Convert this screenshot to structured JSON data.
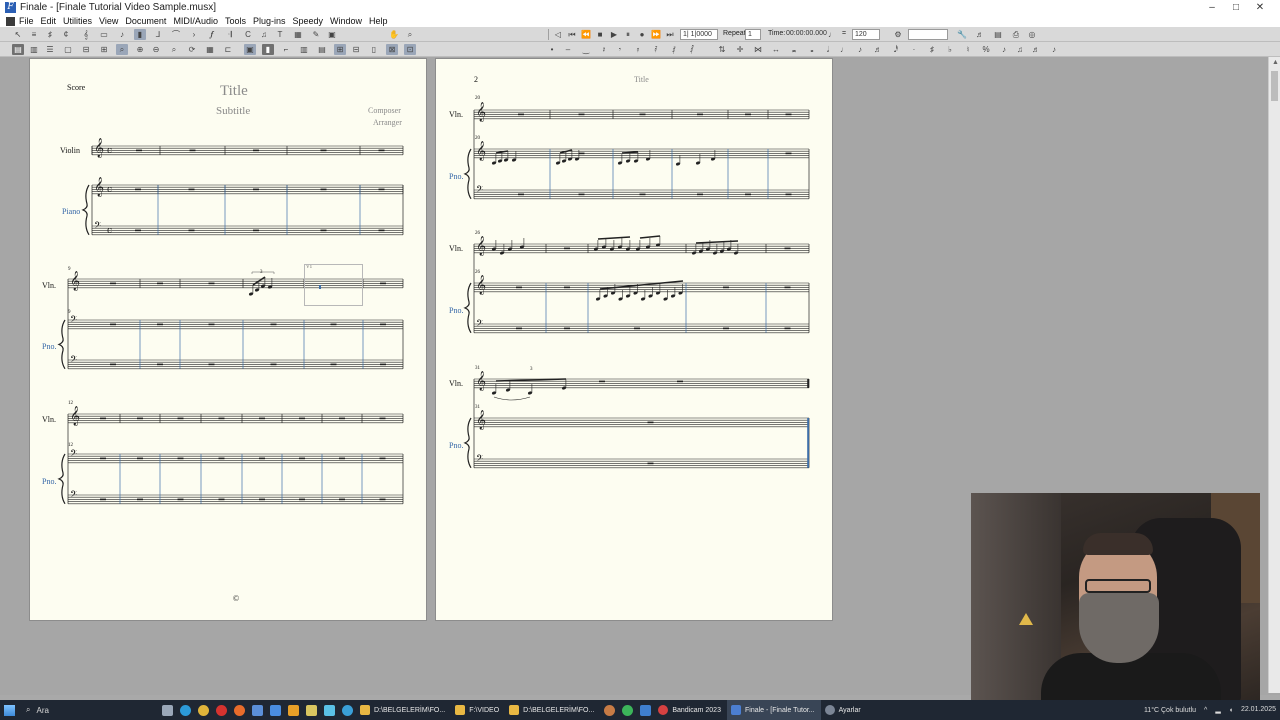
{
  "window": {
    "title": "Finale - [Finale Tutorial Video Sample.musx]",
    "controls": [
      "–",
      "□",
      "✕"
    ]
  },
  "menu": [
    "File",
    "Edit",
    "Utilities",
    "View",
    "Document",
    "MIDI/Audio",
    "Tools",
    "Plug-ins",
    "Speedy",
    "Window",
    "Help"
  ],
  "playback": {
    "counter": "1| 1|0000",
    "repeat_label": "Repeat:",
    "repeat_value": "1",
    "time_label": "Time:",
    "time_value": "00:00:00.000",
    "tempo_eq": "=",
    "tempo_value": "120"
  },
  "page1": {
    "score_label": "Score",
    "title": "Title",
    "subtitle": "Subtitle",
    "composer": "Composer",
    "arranger": "Arranger",
    "violin_label": "Violin",
    "piano_label": "Piano",
    "vln_label": "Vln.",
    "pno_label": "Pno.",
    "measure_9": "9",
    "measure_12": "12",
    "tuplet_3": "3",
    "copyright": "©",
    "selection_label": "V1"
  },
  "page2": {
    "page_number": "2",
    "header_title": "Title",
    "vln_label": "Vln.",
    "pno_label": "Pno.",
    "measure_20": "20",
    "measure_26": "26",
    "measure_31": "31",
    "tuplet_3": "3"
  },
  "taskbar": {
    "search_placeholder": "Ara",
    "apps": [
      {
        "label": "D:\\BELGELERİM\\FO...",
        "color": "#e9b843"
      },
      {
        "label": "F:\\VIDEO",
        "color": "#e9b843"
      },
      {
        "label": "D:\\BELGELERİM\\FO...",
        "color": "#e9b843"
      },
      {
        "label": "Bandicam 2023",
        "color": "#d64141"
      },
      {
        "label": "Finale - [Finale Tutor...",
        "color": "#4c7fd1"
      }
    ],
    "tray_settings": "Ayarlar",
    "weather": "11°C  Çok bulutlu",
    "date": "22.01.2025"
  }
}
